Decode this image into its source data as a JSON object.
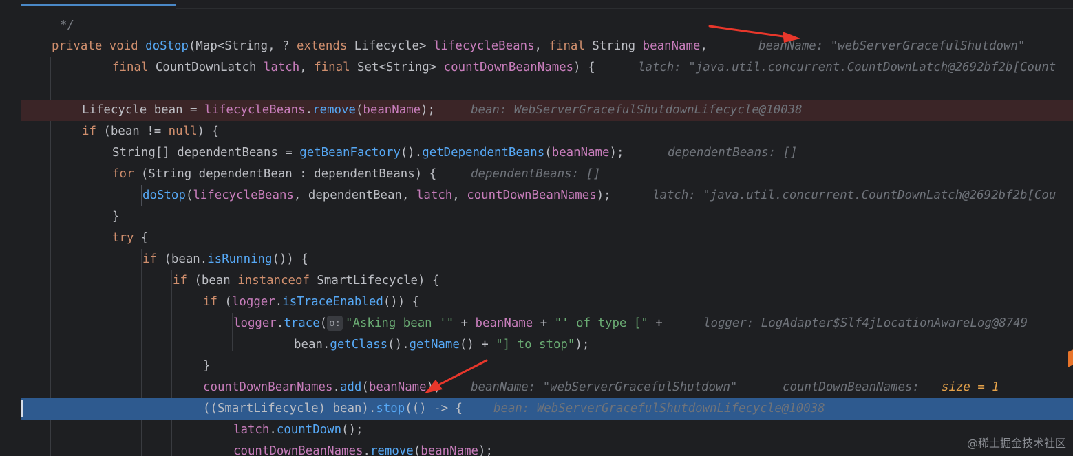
{
  "editor": {
    "lines": [
      {
        "id": "l0",
        "segs": [
          {
            "t": "*/",
            "c": "cmt"
          }
        ]
      },
      {
        "id": "l1",
        "segs": [
          {
            "t": "private void ",
            "c": "kw"
          },
          {
            "t": "doStop",
            "c": "fn"
          },
          {
            "t": "(Map<String, ? ",
            "c": "plain"
          },
          {
            "t": "extends ",
            "c": "kw"
          },
          {
            "t": "Lifecycle> ",
            "c": "plain"
          },
          {
            "t": "lifecycleBeans",
            "c": "var"
          },
          {
            "t": ", ",
            "c": "plain"
          },
          {
            "t": "final ",
            "c": "kw"
          },
          {
            "t": "String ",
            "c": "plain"
          },
          {
            "t": "beanName",
            "c": "var"
          },
          {
            "t": ",",
            "c": "plain"
          }
        ],
        "hint": "beanName: \"webServerGracefulShutdown\""
      },
      {
        "id": "l2",
        "segs": [
          {
            "t": "final ",
            "c": "kw"
          },
          {
            "t": "CountDownLatch ",
            "c": "plain"
          },
          {
            "t": "latch",
            "c": "var"
          },
          {
            "t": ", ",
            "c": "plain"
          },
          {
            "t": "final ",
            "c": "kw"
          },
          {
            "t": "Set<String> ",
            "c": "plain"
          },
          {
            "t": "countDownBeanNames",
            "c": "var"
          },
          {
            "t": ") {",
            "c": "plain"
          }
        ],
        "hint": "latch: \"java.util.concurrent.CountDownLatch@2692bf2b[Count"
      },
      {
        "id": "l3",
        "segs": []
      },
      {
        "id": "l4",
        "segs": [
          {
            "t": "Lifecycle bean = ",
            "c": "plain"
          },
          {
            "t": "lifecycleBeans",
            "c": "var"
          },
          {
            "t": ".",
            "c": "plain"
          },
          {
            "t": "remove",
            "c": "fn"
          },
          {
            "t": "(",
            "c": "plain"
          },
          {
            "t": "beanName",
            "c": "var"
          },
          {
            "t": ");",
            "c": "plain"
          }
        ],
        "hint": "bean: WebServerGracefulShutdownLifecycle@10038"
      },
      {
        "id": "l5",
        "segs": [
          {
            "t": "if ",
            "c": "kw"
          },
          {
            "t": "(bean != ",
            "c": "plain"
          },
          {
            "t": "null",
            "c": "kw"
          },
          {
            "t": ") {",
            "c": "plain"
          }
        ]
      },
      {
        "id": "l6",
        "segs": [
          {
            "t": "String[] dependentBeans = ",
            "c": "plain"
          },
          {
            "t": "getBeanFactory",
            "c": "fn"
          },
          {
            "t": "().",
            "c": "plain"
          },
          {
            "t": "getDependentBeans",
            "c": "fn"
          },
          {
            "t": "(",
            "c": "plain"
          },
          {
            "t": "beanName",
            "c": "var"
          },
          {
            "t": ");",
            "c": "plain"
          }
        ],
        "hint": "dependentBeans: []"
      },
      {
        "id": "l7",
        "segs": [
          {
            "t": "for ",
            "c": "kw"
          },
          {
            "t": "(String dependentBean : dependentBeans) {",
            "c": "plain"
          }
        ],
        "hint": "dependentBeans: []"
      },
      {
        "id": "l8",
        "segs": [
          {
            "t": "doStop",
            "c": "fn"
          },
          {
            "t": "(",
            "c": "plain"
          },
          {
            "t": "lifecycleBeans",
            "c": "var"
          },
          {
            "t": ", dependentBean, ",
            "c": "plain"
          },
          {
            "t": "latch",
            "c": "var"
          },
          {
            "t": ", ",
            "c": "plain"
          },
          {
            "t": "countDownBeanNames",
            "c": "var"
          },
          {
            "t": ");",
            "c": "plain"
          }
        ],
        "hint": "latch: \"java.util.concurrent.CountDownLatch@2692bf2b[Cou"
      },
      {
        "id": "l9",
        "segs": [
          {
            "t": "}",
            "c": "plain"
          }
        ]
      },
      {
        "id": "l10",
        "segs": [
          {
            "t": "try ",
            "c": "kw"
          },
          {
            "t": "{",
            "c": "plain"
          }
        ]
      },
      {
        "id": "l11",
        "segs": [
          {
            "t": "if ",
            "c": "kw"
          },
          {
            "t": "(bean.",
            "c": "plain"
          },
          {
            "t": "isRunning",
            "c": "fn"
          },
          {
            "t": "()) {",
            "c": "plain"
          }
        ]
      },
      {
        "id": "l12",
        "segs": [
          {
            "t": "if ",
            "c": "kw"
          },
          {
            "t": "(bean ",
            "c": "plain"
          },
          {
            "t": "instanceof ",
            "c": "kw"
          },
          {
            "t": "SmartLifecycle) {",
            "c": "plain"
          }
        ]
      },
      {
        "id": "l13",
        "segs": [
          {
            "t": "if ",
            "c": "kw"
          },
          {
            "t": "(",
            "c": "plain"
          },
          {
            "t": "logger",
            "c": "var"
          },
          {
            "t": ".",
            "c": "plain"
          },
          {
            "t": "isTraceEnabled",
            "c": "fn"
          },
          {
            "t": "()) {",
            "c": "plain"
          }
        ]
      },
      {
        "id": "l14",
        "segs": [
          {
            "t": "logger",
            "c": "var"
          },
          {
            "t": ".",
            "c": "plain"
          },
          {
            "t": "trace",
            "c": "fn"
          },
          {
            "t": "(",
            "c": "plain"
          },
          {
            "t": "o:",
            "c": "param"
          },
          {
            "t": "\"Asking bean '\"",
            "c": "str"
          },
          {
            "t": " + ",
            "c": "plain"
          },
          {
            "t": "beanName",
            "c": "var"
          },
          {
            "t": " + ",
            "c": "plain"
          },
          {
            "t": "\"' of type [\"",
            "c": "str"
          },
          {
            "t": " +",
            "c": "plain"
          }
        ],
        "hint": "logger: LogAdapter$Slf4jLocationAwareLog@8749"
      },
      {
        "id": "l15",
        "segs": [
          {
            "t": "bean.",
            "c": "plain"
          },
          {
            "t": "getClass",
            "c": "fn"
          },
          {
            "t": "().",
            "c": "plain"
          },
          {
            "t": "getName",
            "c": "fn"
          },
          {
            "t": "() + ",
            "c": "plain"
          },
          {
            "t": "\"] to stop\"",
            "c": "str"
          },
          {
            "t": ");",
            "c": "plain"
          }
        ]
      },
      {
        "id": "l16",
        "segs": [
          {
            "t": "}",
            "c": "plain"
          }
        ]
      },
      {
        "id": "l17",
        "segs": [
          {
            "t": "countDownBeanNames",
            "c": "var"
          },
          {
            "t": ".",
            "c": "plain"
          },
          {
            "t": "add",
            "c": "fn"
          },
          {
            "t": "(",
            "c": "plain"
          },
          {
            "t": "beanName",
            "c": "var"
          },
          {
            "t": ");",
            "c": "plain"
          }
        ],
        "hint": "beanName: \"webServerGracefulShutdown\"",
        "hint2": "countDownBeanNames:",
        "hint3": "size = 1"
      },
      {
        "id": "l18",
        "segs": [
          {
            "t": "((",
            "c": "plain"
          },
          {
            "t": "SmartLifecycle",
            "c": "plain"
          },
          {
            "t": ") ",
            "c": "plain"
          },
          {
            "t": "bean",
            "c": "plain"
          },
          {
            "t": ").",
            "c": "plain"
          },
          {
            "t": "stop",
            "c": "fn"
          },
          {
            "t": "(() -> {",
            "c": "plain"
          }
        ],
        "hint": "bean: WebServerGracefulShutdownLifecycle@10038"
      },
      {
        "id": "l19",
        "segs": [
          {
            "t": "latch",
            "c": "var"
          },
          {
            "t": ".",
            "c": "plain"
          },
          {
            "t": "countDown",
            "c": "fn"
          },
          {
            "t": "();",
            "c": "plain"
          }
        ]
      },
      {
        "id": "l20",
        "segs": [
          {
            "t": "countDownBeanNames",
            "c": "var"
          },
          {
            "t": ".",
            "c": "plain"
          },
          {
            "t": "remove",
            "c": "fn"
          },
          {
            "t": "(",
            "c": "plain"
          },
          {
            "t": "beanName",
            "c": "var"
          },
          {
            "t": ");",
            "c": "plain"
          }
        ]
      }
    ]
  },
  "watermark": "@稀土掘金技术社区",
  "colors": {
    "breakpoint_line": "#3b2527",
    "current_line": "#2e5a8f",
    "arrow": "#e8372b"
  }
}
